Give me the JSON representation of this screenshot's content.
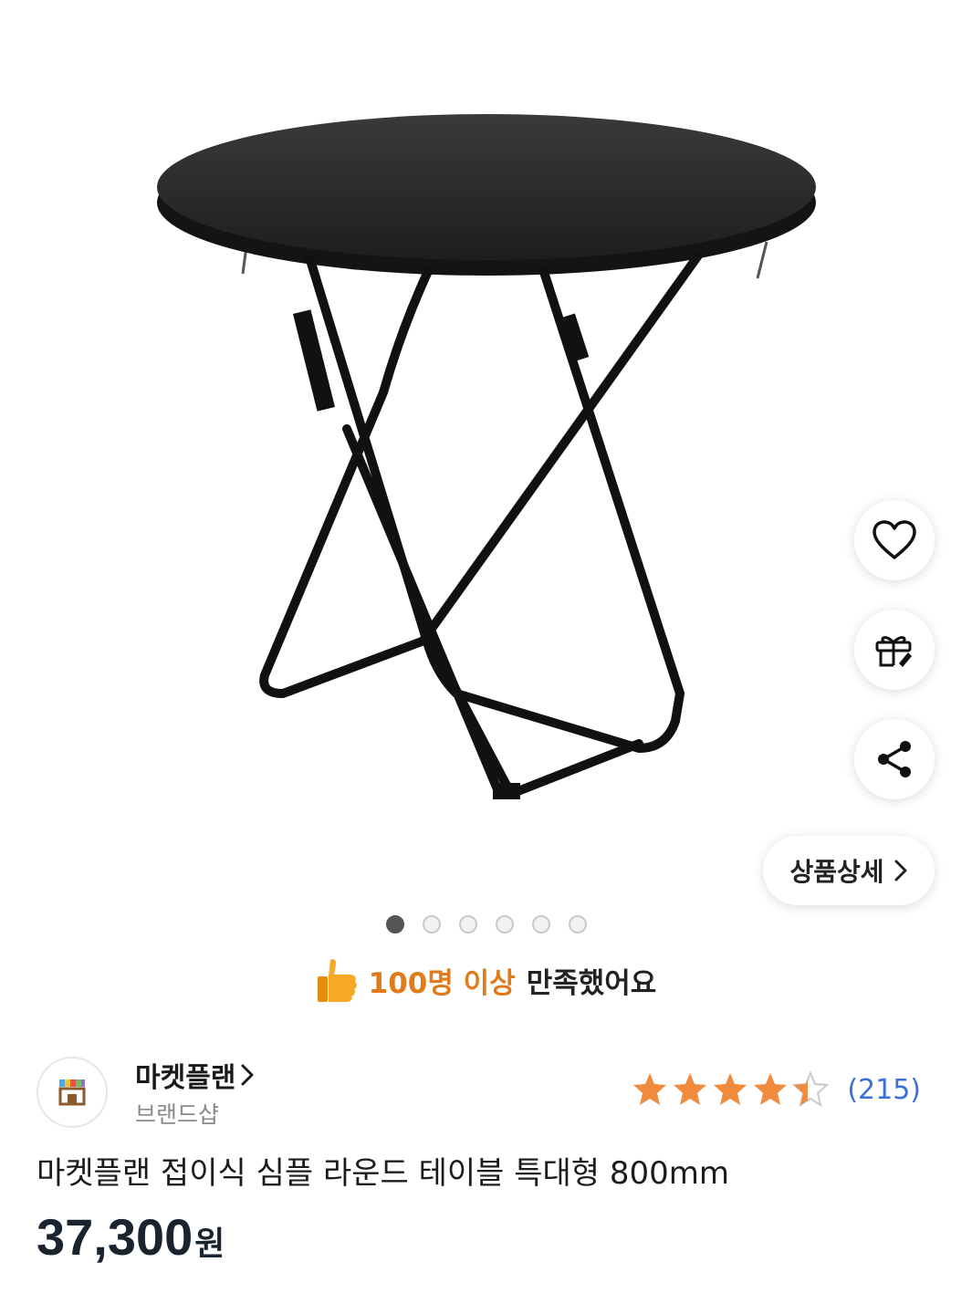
{
  "product": {
    "image_alt": "folding round table",
    "title": "마켓플랜 접이식 심플 라운드 테이블 특대형 800mm",
    "price_value": "37,300",
    "price_unit": "원"
  },
  "actions": {
    "wishlist_icon": "heart-icon",
    "gift_icon": "gift-icon",
    "share_icon": "share-icon",
    "detail_label": "상품상세"
  },
  "carousel": {
    "total": 6,
    "active_index": 0
  },
  "satisfaction": {
    "highlight": "100명 이상",
    "text": "만족했어요",
    "icon": "thumbs-up-icon"
  },
  "brand": {
    "name": "마켓플랜",
    "type": "브랜드샵"
  },
  "rating": {
    "stars": 4.5,
    "review_count": "(215)",
    "star_color": "#f08a3c"
  },
  "colors": {
    "accent_orange": "#e07a1a",
    "link_blue": "#3b6fd8"
  }
}
